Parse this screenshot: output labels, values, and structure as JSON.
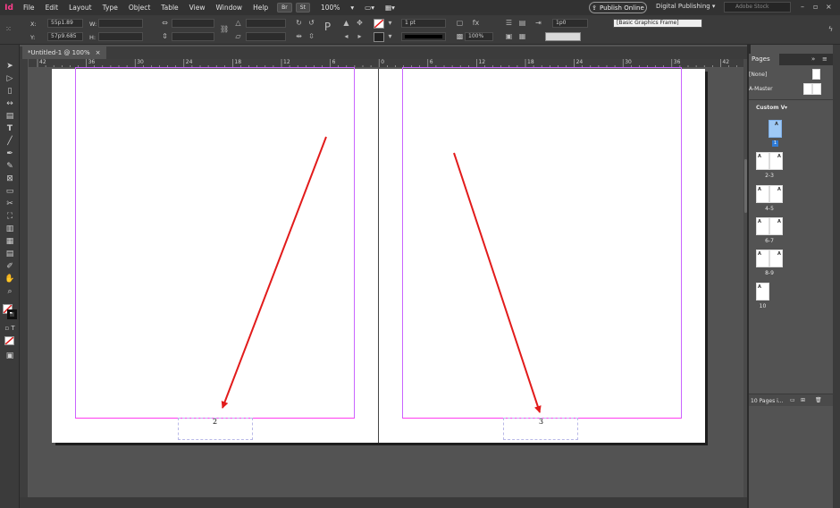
{
  "app": {
    "logo": "Id",
    "accent": "#ff3d8b"
  },
  "menu": {
    "items": [
      "File",
      "Edit",
      "Layout",
      "Type",
      "Object",
      "Table",
      "View",
      "Window",
      "Help"
    ],
    "bridge": "Br",
    "stock": "St",
    "zoom": "100%",
    "publish_label": "Publish Online",
    "workspace": "Digital Publishing",
    "search_placeholder": "Adobe Stock"
  },
  "control": {
    "x_label": "X:",
    "x_value": "55p1.89",
    "y_label": "Y:",
    "y_value": "57p9.685",
    "w_label": "W:",
    "h_label": "H:",
    "stroke_weight": "1 pt",
    "opacity": "100%",
    "offset": "1p0",
    "object_style": "[Basic Graphics Frame]"
  },
  "document": {
    "tab_title": "*Untitled-1 @ 100%",
    "close_glyph": "×",
    "page_numbers": [
      "2",
      "3"
    ]
  },
  "ruler": {
    "labels": [
      "42",
      "36",
      "30",
      "24",
      "18",
      "12",
      "6",
      "0",
      "6",
      "12",
      "18",
      "24",
      "30",
      "36",
      "42"
    ]
  },
  "pages_panel": {
    "title": "Pages",
    "none_label": "[None]",
    "master_label": "A-Master",
    "view_label": "Custom V",
    "master_prefix": "A",
    "spreads": [
      "1",
      "2-3",
      "4-5",
      "6-7",
      "8-9",
      "10"
    ],
    "footer_label": "10 Pages i..."
  },
  "colors": {
    "arrow": "#e21b1b",
    "margin_guide": "#c964ff",
    "page_selected": "#9ec9f5"
  }
}
